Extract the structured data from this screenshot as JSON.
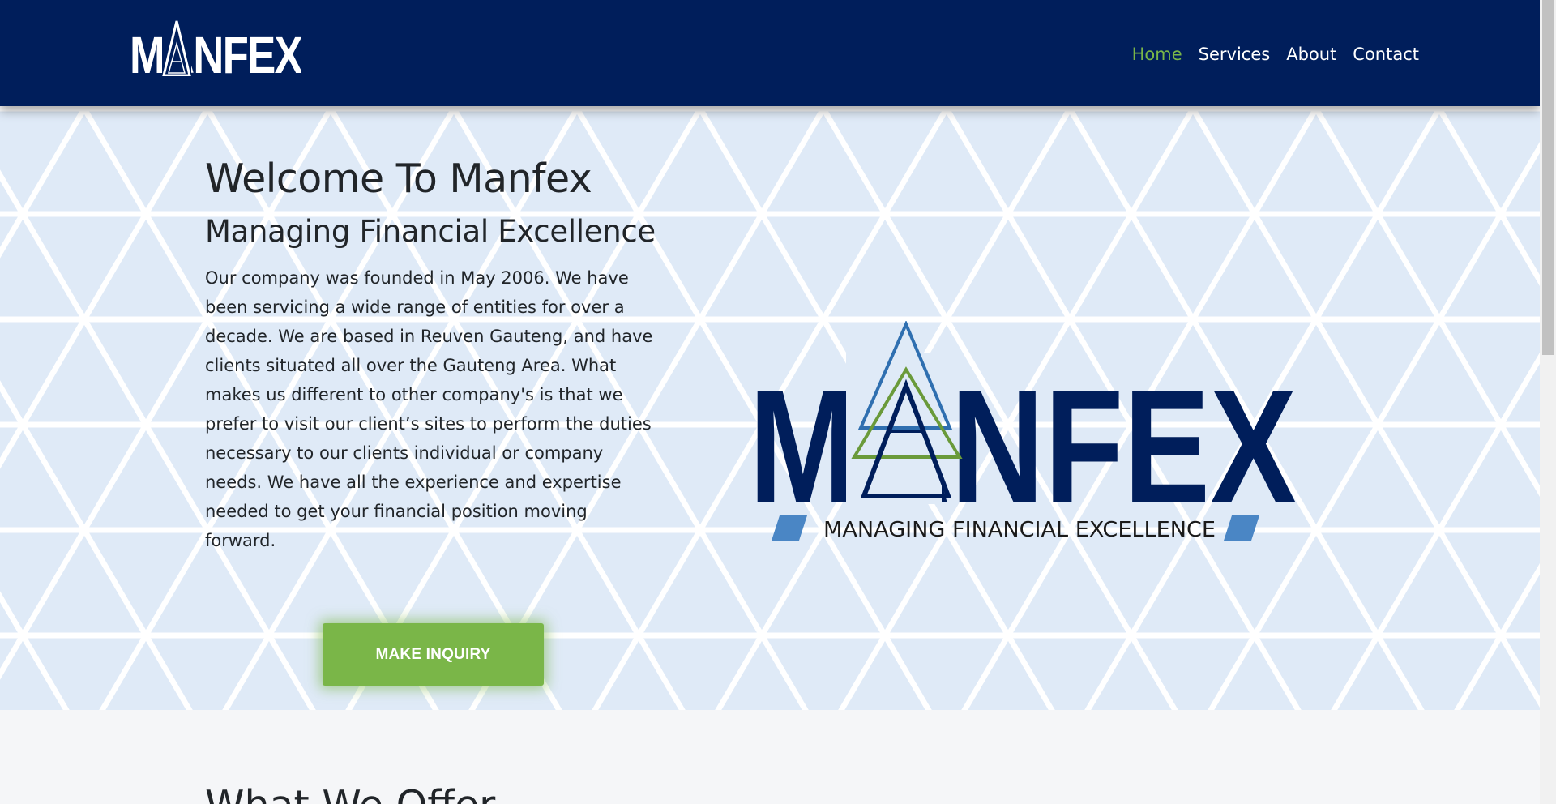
{
  "header": {
    "brand": "MANFEX",
    "nav": [
      {
        "label": "Home",
        "active": true
      },
      {
        "label": "Services",
        "active": false
      },
      {
        "label": "About",
        "active": false
      },
      {
        "label": "Contact",
        "active": false
      }
    ]
  },
  "hero": {
    "title": "Welcome To Manfex",
    "subtitle": "Managing Financial Excellence",
    "body": "Our company was founded in May 2006. We have been servicing a wide range of entities for over a decade. We are based in Reuven Gauteng, and have clients situated all over the Gauteng Area. What makes us different to other company's is that we prefer to visit our client’s sites to perform the duties necessary to our clients individual or company needs. We have all the experience and expertise needed to get your financial position moving forward.",
    "cta_label": "MAKE INQUIRY",
    "logo": {
      "wordmark": "MANFEX",
      "tagline": "MANAGING FINANCIAL EXCELLENCE"
    }
  },
  "offer": {
    "title": "What We Offer"
  },
  "colors": {
    "navy": "#001e5b",
    "green": "#7ab648",
    "light_blue": "#dfeaf7",
    "accent_blue": "#4a86c5"
  }
}
